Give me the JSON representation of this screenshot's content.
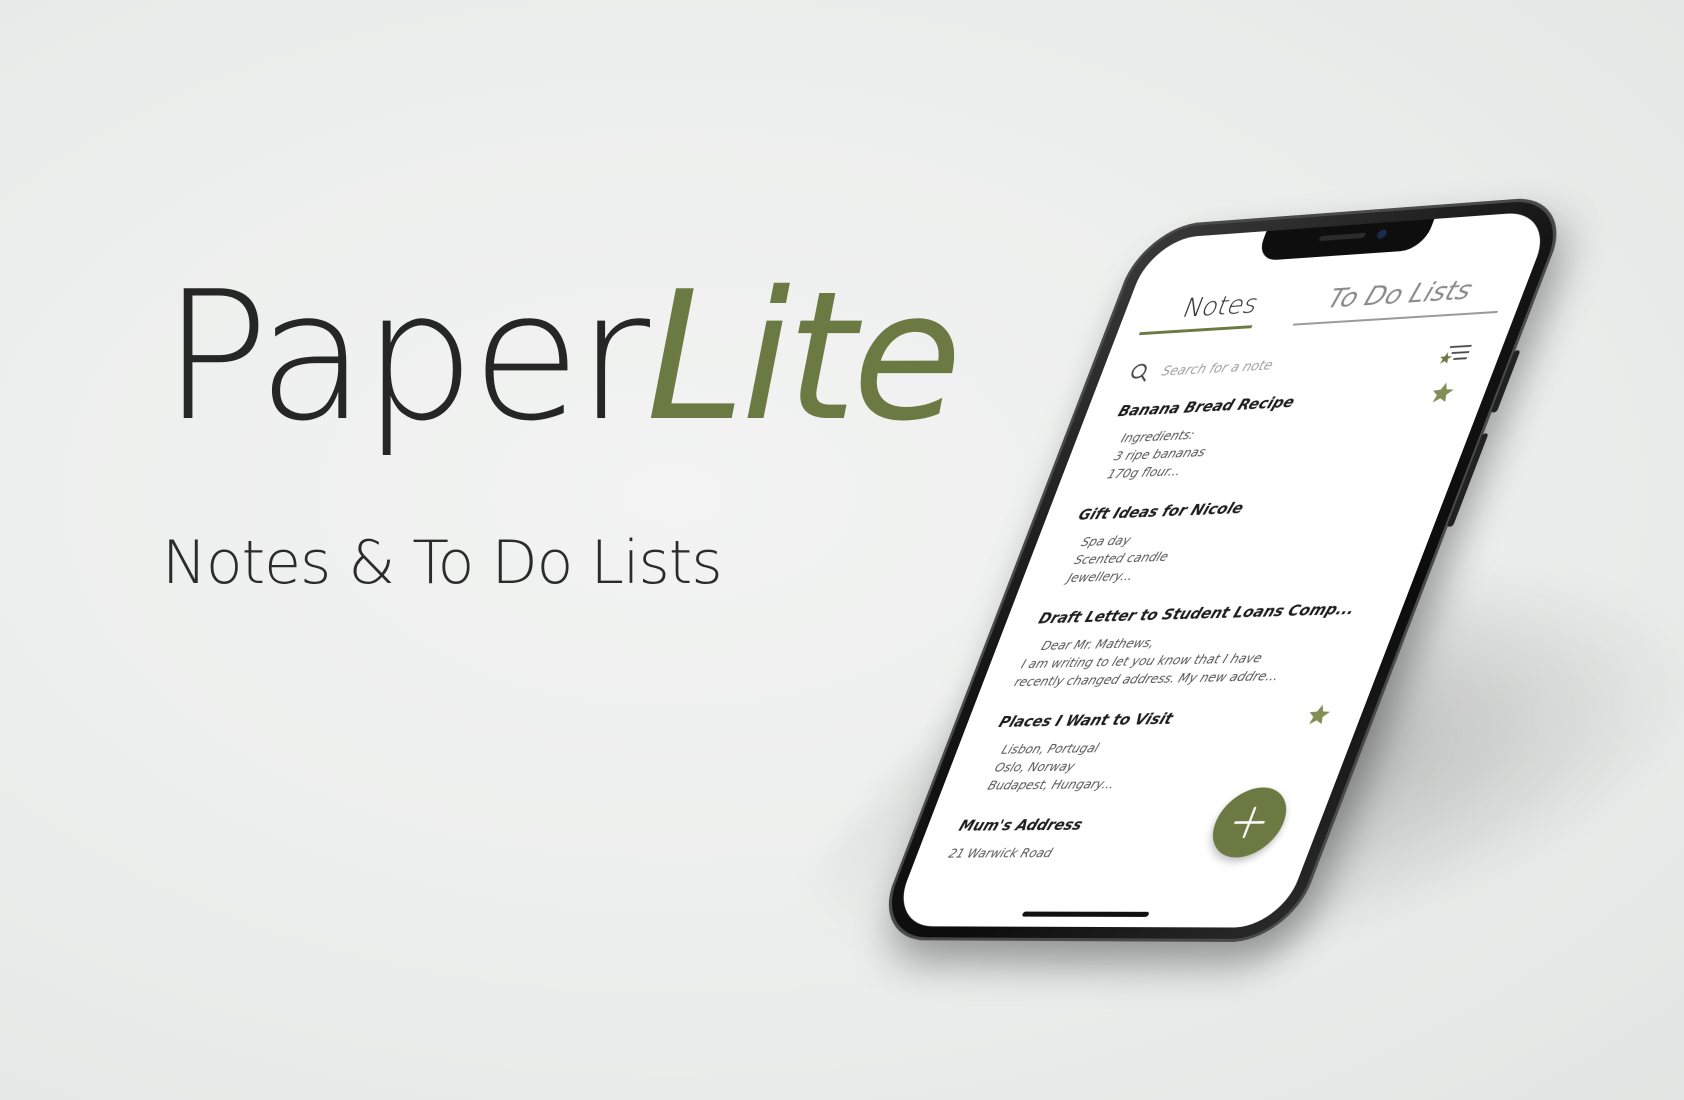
{
  "hero": {
    "brand_part1": "Paper",
    "brand_part2": "Lite",
    "tagline": "Notes & To Do Lists"
  },
  "colors": {
    "accent": "#6a7a42",
    "text_dark": "#262626",
    "background": "#eceeed",
    "phone_body": "#111111"
  },
  "app": {
    "tabs": [
      {
        "label": "Notes",
        "active": true
      },
      {
        "label": "To Do Lists",
        "active": false
      }
    ],
    "search": {
      "placeholder": "Search for a note",
      "icon": "search-icon"
    },
    "filter_icon": "filter-icon",
    "notes": [
      {
        "title": "Banana Bread Recipe",
        "starred": true,
        "lines": [
          "Ingredients:",
          "3 ripe bananas",
          "170g flour..."
        ]
      },
      {
        "title": "Gift Ideas for Nicole",
        "starred": false,
        "lines": [
          "Spa day",
          "Scented candle",
          "Jewellery..."
        ]
      },
      {
        "title": "Draft Letter to Student Loans Comp...",
        "starred": false,
        "lines": [
          "Dear Mr. Mathews,",
          "I am writing to let you know that I have",
          "recently changed address. My new addre..."
        ]
      },
      {
        "title": "Places I Want to Visit",
        "starred": true,
        "lines": [
          "Lisbon, Portugal",
          "Oslo, Norway",
          "Budapest, Hungary..."
        ]
      },
      {
        "title": "Mum's Address",
        "starred": false,
        "lines": [
          "21 Warwick Road"
        ]
      }
    ],
    "fab_icon": "plus-icon"
  }
}
